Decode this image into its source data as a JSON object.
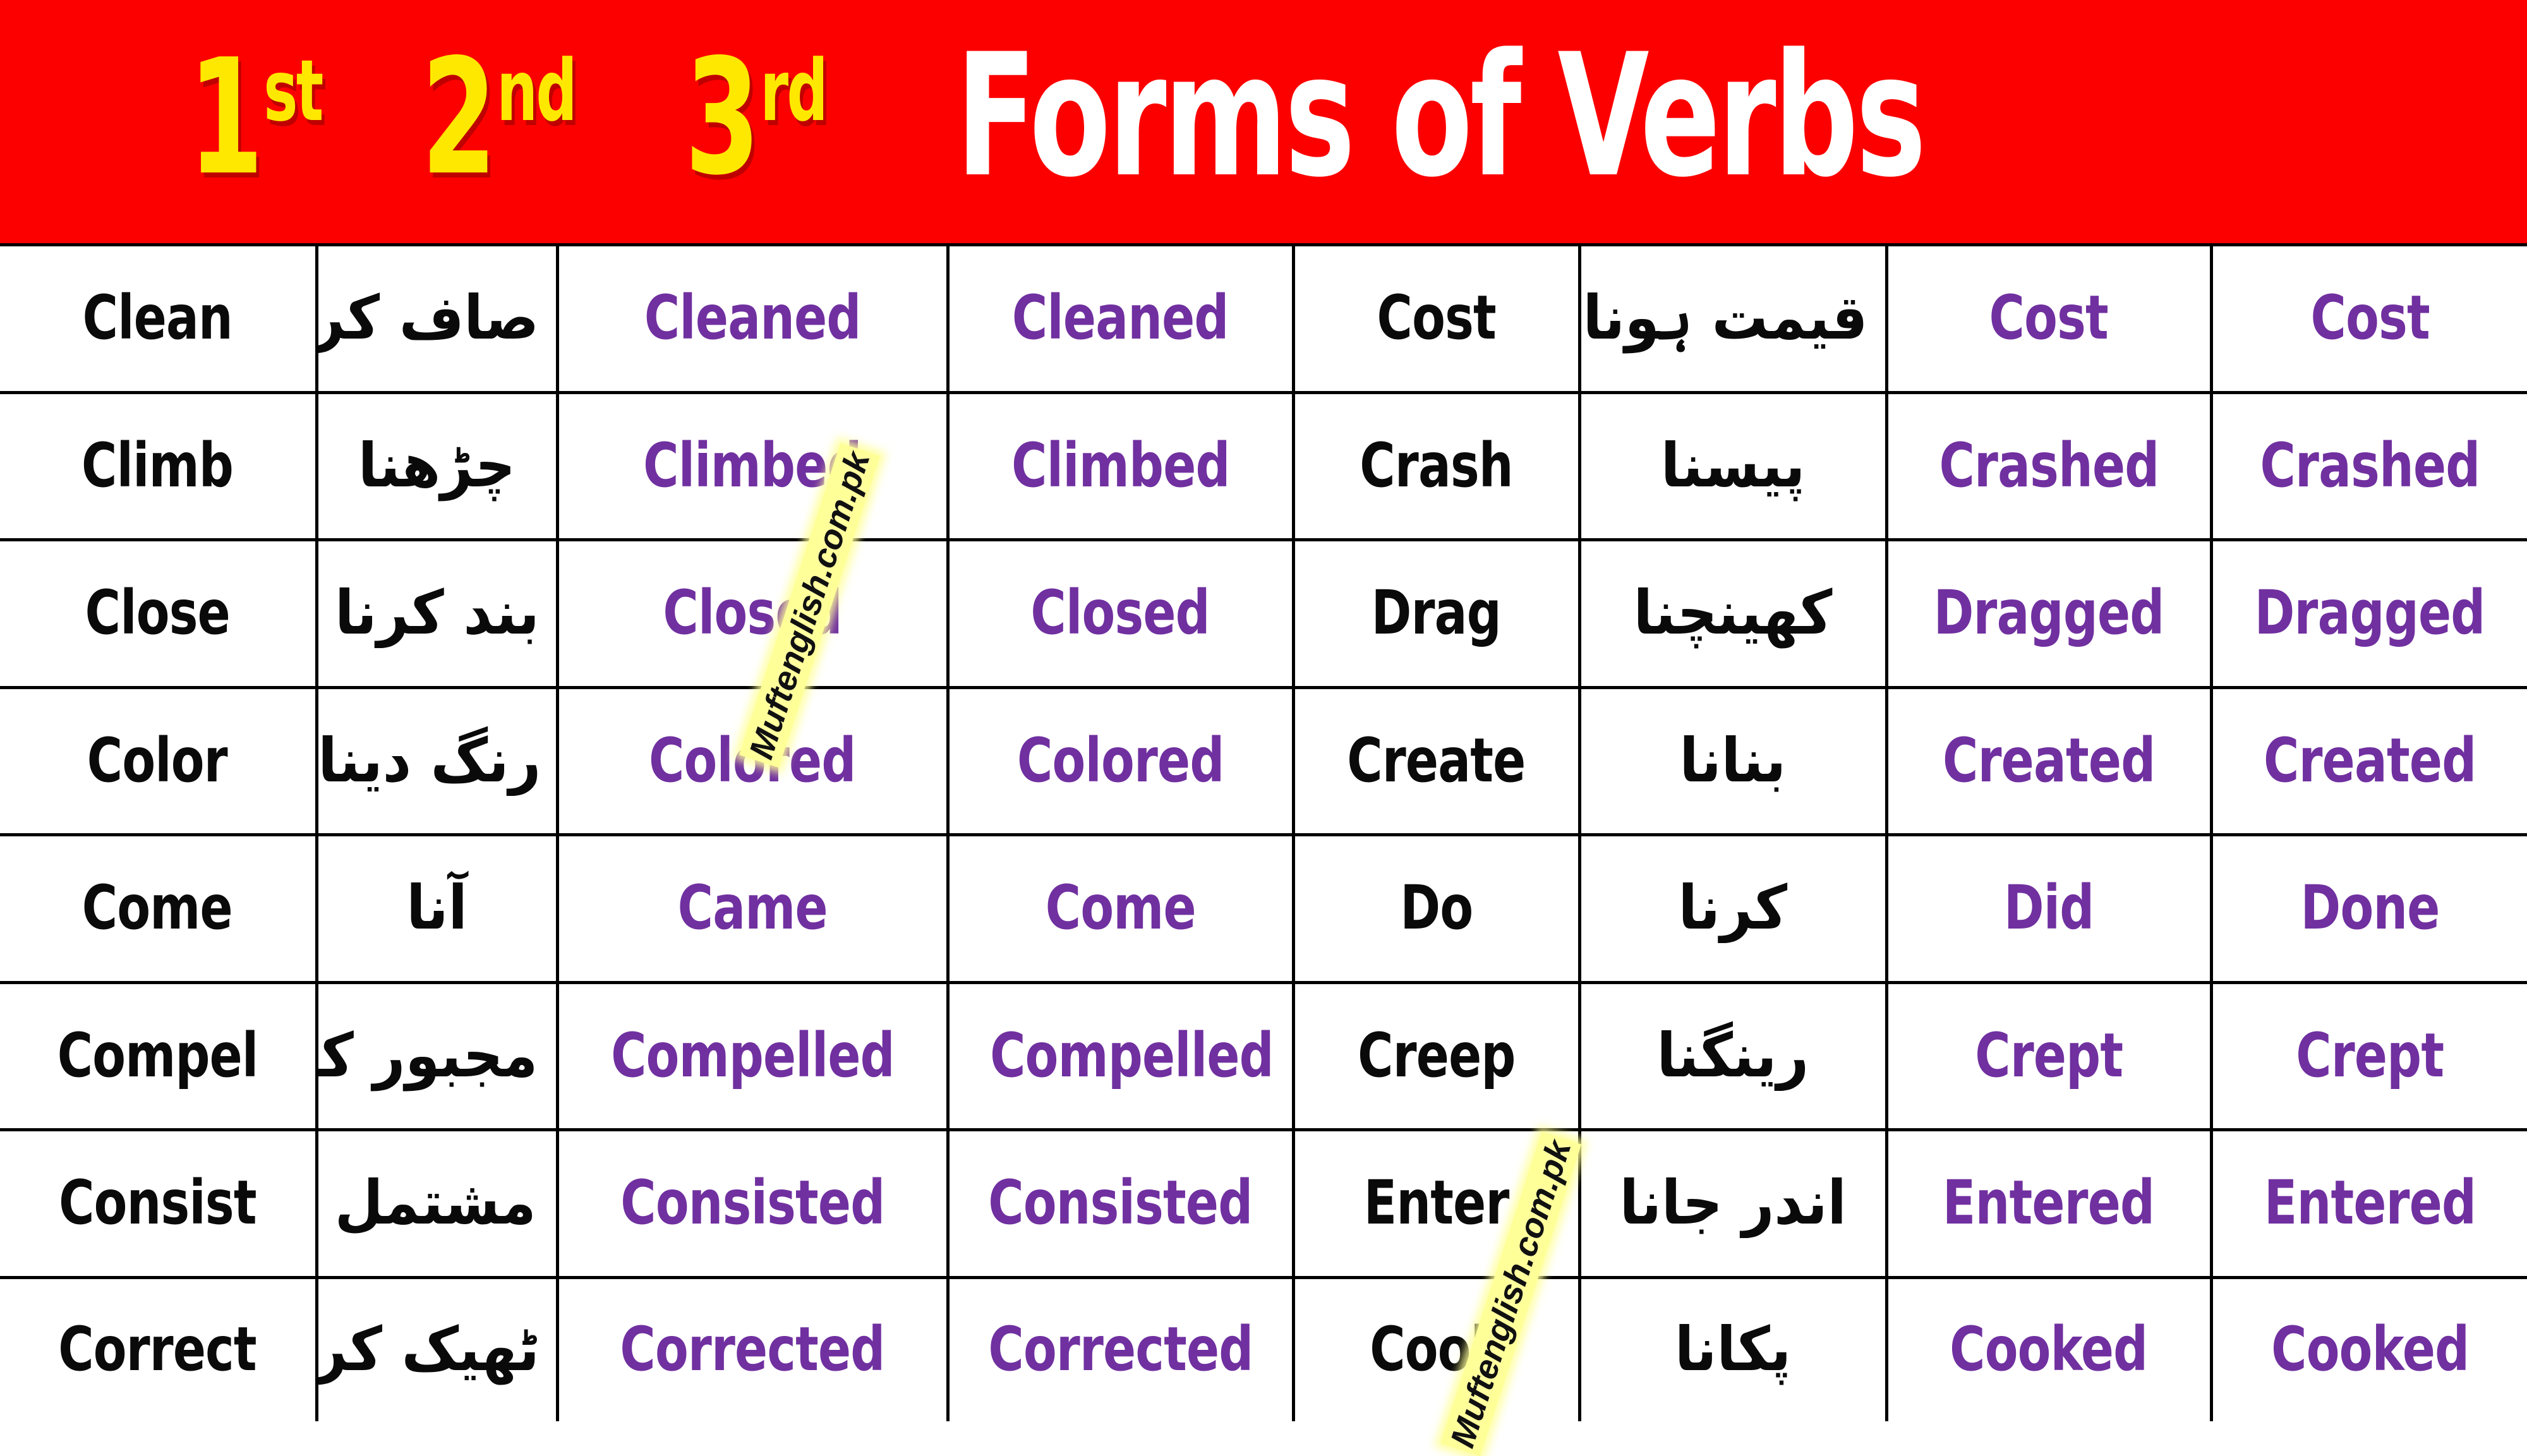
{
  "header": {
    "ordinals": [
      {
        "num": "1",
        "suffix": "st"
      },
      {
        "num": "2",
        "suffix": "nd"
      },
      {
        "num": "3",
        "suffix": "rd"
      }
    ],
    "title": "Forms of Verbs",
    "background_color": "#FC0000",
    "ordinal_color": "#FFE800",
    "title_color": "#FFFFFF"
  },
  "watermark": {
    "text": "Muftenglish.com.pk",
    "highlight_color": "#FFFF99",
    "text_color": "#111111"
  },
  "table": {
    "base_color": "#0A0A0A",
    "past_color": "#7030A0",
    "border_color": "#000000",
    "columns": 8,
    "column_roles": [
      "base-verb-left",
      "urdu-meaning-left",
      "past-simple-left",
      "past-participle-left",
      "base-verb-right",
      "urdu-meaning-right",
      "past-simple-right",
      "past-participle-right"
    ],
    "rows": [
      {
        "left": {
          "base": "Clean",
          "urdu": "صاف کرنا",
          "past": "Cleaned",
          "pp": "Cleaned"
        },
        "right": {
          "base": "Cost",
          "urdu": "قیمت ہونا",
          "past": "Cost",
          "pp": "Cost"
        }
      },
      {
        "left": {
          "base": "Climb",
          "urdu": "چڑھنا",
          "past": "Climbed",
          "pp": "Climbed"
        },
        "right": {
          "base": "Crash",
          "urdu": "پیسنا",
          "past": "Crashed",
          "pp": "Crashed"
        }
      },
      {
        "left": {
          "base": "Close",
          "urdu": "بند کرنا",
          "past": "Closed",
          "pp": "Closed"
        },
        "right": {
          "base": "Drag",
          "urdu": "کھینچنا",
          "past": "Dragged",
          "pp": "Dragged"
        }
      },
      {
        "left": {
          "base": "Color",
          "urdu": "رنگ دینا",
          "past": "Colored",
          "pp": "Colored"
        },
        "right": {
          "base": "Create",
          "urdu": "بنانا",
          "past": "Created",
          "pp": "Created"
        }
      },
      {
        "left": {
          "base": "Come",
          "urdu": "آنا",
          "past": "Came",
          "pp": "Come"
        },
        "right": {
          "base": "Do",
          "urdu": "کرنا",
          "past": "Did",
          "pp": "Done"
        }
      },
      {
        "left": {
          "base": "Compel",
          "urdu": "مجبور کرنا",
          "past": "Compelled",
          "pp": "Compelled"
        },
        "right": {
          "base": "Creep",
          "urdu": "رینگنا",
          "past": "Crept",
          "pp": "Crept"
        }
      },
      {
        "left": {
          "base": "Consist",
          "urdu": "مشتمل ہونا",
          "past": "Consisted",
          "pp": "Consisted"
        },
        "right": {
          "base": "Enter",
          "urdu": "اندر جانا",
          "past": "Entered",
          "pp": "Entered"
        }
      },
      {
        "left": {
          "base": "Correct",
          "urdu": "ٹھیک کرنا",
          "past": "Corrected",
          "pp": "Corrected"
        },
        "right": {
          "base": "Cook",
          "urdu": "پکانا",
          "past": "Cooked",
          "pp": "Cooked"
        }
      }
    ]
  }
}
